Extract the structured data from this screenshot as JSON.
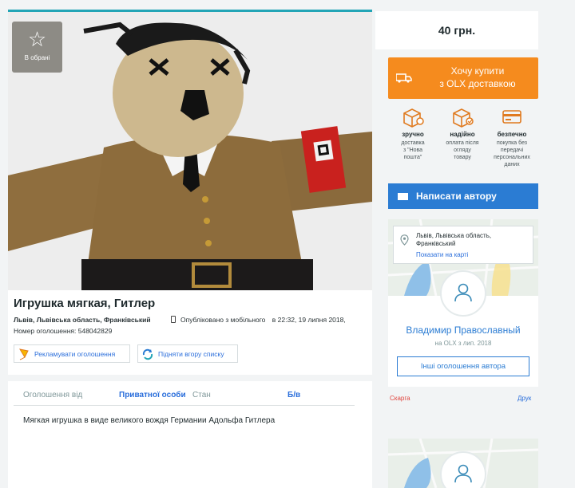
{
  "favorite": {
    "label": "В обрані",
    "icon": "star-icon"
  },
  "ad": {
    "title": "Игрушка мягкая, Гитлер",
    "location": "Львів, Львівська область, Франківський",
    "published_label": "Опубліковано з мобільного",
    "published_time": "в 22:32, 19 липня 2018,",
    "ad_number": "Номер оголошення: 548042829",
    "promote_label": "Рекламувати оголошення",
    "raise_label": "Підняти вгору списку"
  },
  "params": {
    "offered_by_label": "Оголошення від",
    "offered_by_value": "Приватної особи",
    "condition_label": "Стан",
    "condition_value": "Б/в"
  },
  "description": "Мягкая игрушка в виде великого вождя Германии Адольфа Гитлера",
  "price": "40 грн.",
  "buy_button": {
    "line1": "Хочу купити",
    "line2": "з OLX доставкою"
  },
  "features": [
    {
      "title": "зручно",
      "desc": [
        "доставка",
        "з \"Нова",
        "пошта\""
      ],
      "icon": "package-pin-icon"
    },
    {
      "title": "надійно",
      "desc": [
        "оплата після",
        "огляду",
        "товару"
      ],
      "icon": "package-check-icon"
    },
    {
      "title": "безпечно",
      "desc": [
        "покупка без",
        "передачі",
        "персональних",
        "даних"
      ],
      "icon": "card-icon"
    }
  ],
  "message_button": "Написати автору",
  "seller": {
    "location_line1": "Львів, Львівська область,",
    "location_line2": "Франківський",
    "show_on_map": "Показати на карті",
    "name": "Владимир Православный",
    "since": "на OLX з лип. 2018",
    "other_ads": "Інші оголошення автора"
  },
  "footer": {
    "complaint": "Скарга",
    "print": "Друк"
  },
  "colors": {
    "accent_blue": "#2b7cd3",
    "orange": "#f58b1e",
    "teal": "#23a5b6"
  }
}
